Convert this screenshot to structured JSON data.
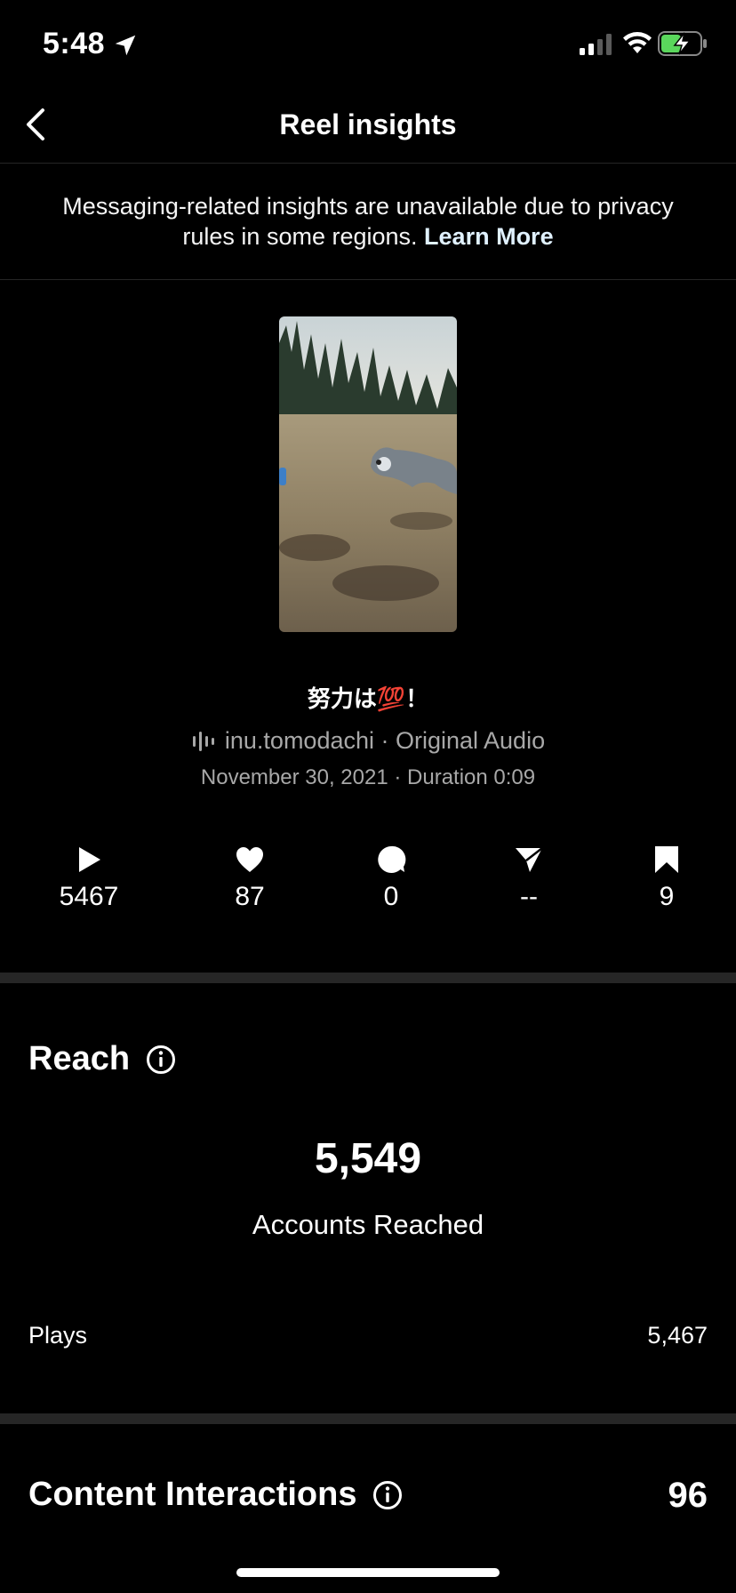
{
  "status_bar": {
    "time": "5:48"
  },
  "nav": {
    "title": "Reel insights"
  },
  "notice": {
    "text": "Messaging-related insights are unavailable due to privacy rules in some regions.",
    "link": "Learn More"
  },
  "reel": {
    "caption": "努力は💯！",
    "audio": "inu.tomodachi · Original Audio",
    "meta": "November 30, 2021 · Duration 0:09"
  },
  "stats": {
    "plays": "5467",
    "likes": "87",
    "comments": "0",
    "shares": "--",
    "saves": "9"
  },
  "reach": {
    "title": "Reach",
    "accounts_reached_value": "5,549",
    "accounts_reached_label": "Accounts Reached",
    "plays_label": "Plays",
    "plays_value": "5,467"
  },
  "content_interactions": {
    "title": "Content Interactions",
    "value": "96"
  }
}
